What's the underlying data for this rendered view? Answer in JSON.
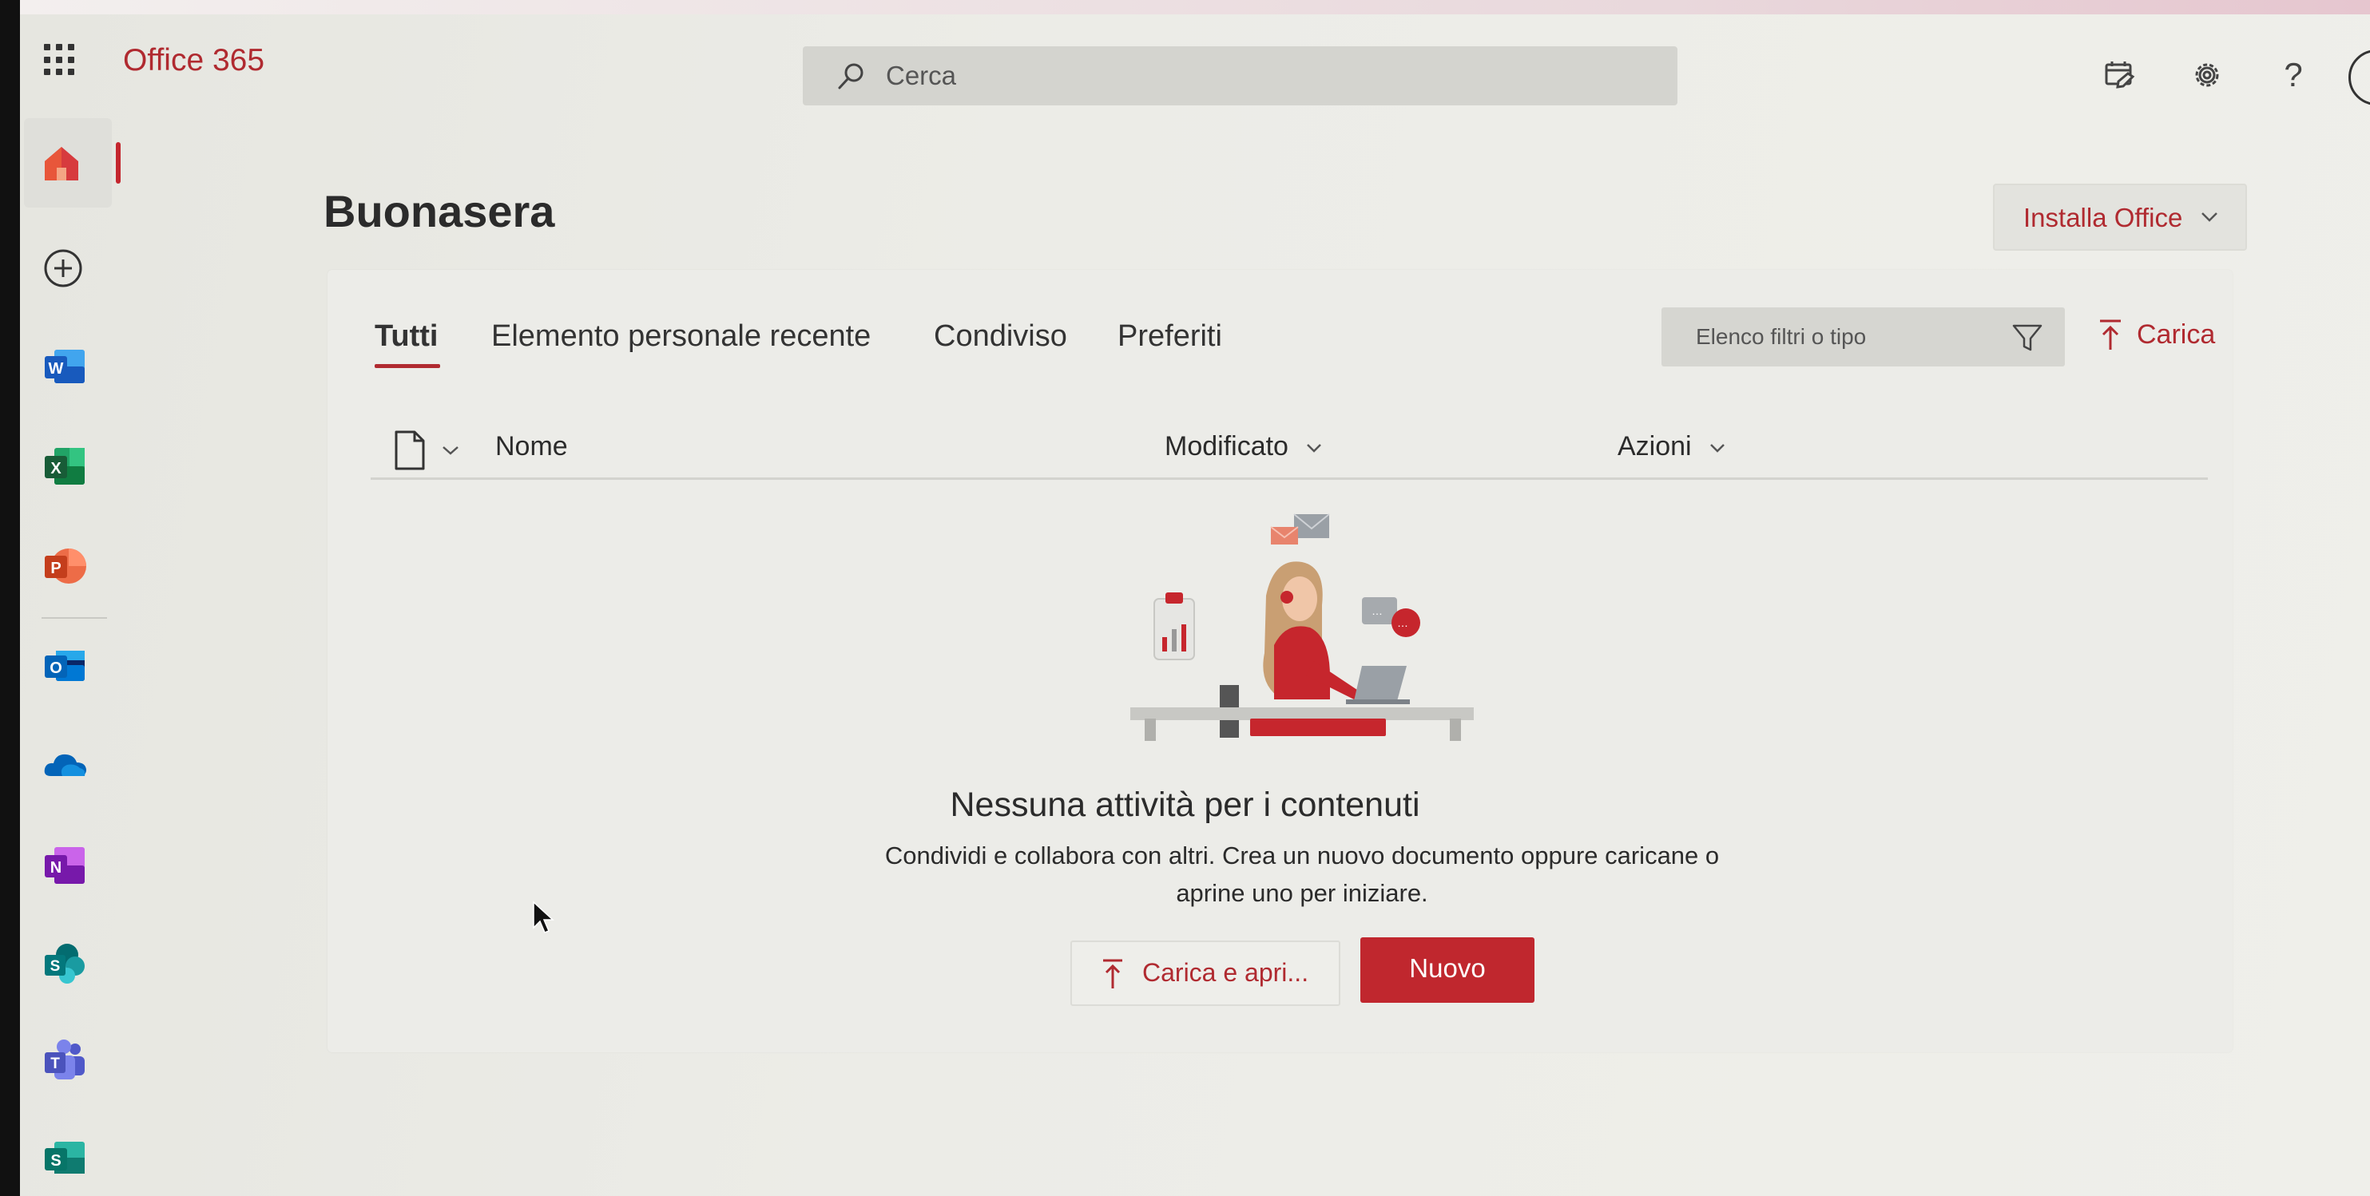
{
  "app": {
    "title": "Office 365"
  },
  "search": {
    "placeholder": "Cerca"
  },
  "header_icons": [
    "waffle-icon",
    "my-day-icon",
    "gear-icon",
    "help-icon",
    "avatar"
  ],
  "help": {
    "glyph": "?"
  },
  "left_rail": {
    "items": [
      {
        "name": "home",
        "icon": "home-icon",
        "active": true
      },
      {
        "name": "create",
        "icon": "add-circle-icon"
      },
      {
        "name": "word",
        "icon": "word-icon",
        "letter": "W",
        "color": "#2b579a"
      },
      {
        "name": "excel",
        "icon": "excel-icon",
        "letter": "X",
        "color": "#217346"
      },
      {
        "name": "powerpoint",
        "icon": "powerpoint-icon",
        "letter": "P",
        "color": "#d24726"
      },
      {
        "name": "outlook",
        "icon": "outlook-icon",
        "letter": "O",
        "color": "#0078d4"
      },
      {
        "name": "onedrive",
        "icon": "onedrive-icon",
        "color": "#0364b8"
      },
      {
        "name": "onenote",
        "icon": "onenote-icon",
        "letter": "N",
        "color": "#7719aa"
      },
      {
        "name": "sharepoint",
        "icon": "sharepoint-icon",
        "letter": "S",
        "color": "#038387"
      },
      {
        "name": "teams",
        "icon": "teams-icon",
        "color": "#4b53bc"
      },
      {
        "name": "sway",
        "icon": "sway-icon",
        "letter": "S",
        "color": "#008272"
      }
    ]
  },
  "main": {
    "greeting": "Buonasera",
    "install_button": "Installa Office",
    "tabs": [
      {
        "label": "Tutti",
        "active": true
      },
      {
        "label": "Elemento personale recente"
      },
      {
        "label": "Condiviso"
      },
      {
        "label": "Preferiti"
      }
    ],
    "filter_placeholder": "Elenco filtri o tipo",
    "upload_label": "Carica",
    "columns": {
      "name": "Nome",
      "modified": "Modificato",
      "actions": "Azioni"
    },
    "empty_state": {
      "title": "Nessuna attività per i contenuti",
      "subtitle_line1": "Condividi e collabora con altri. Crea un nuovo documento oppure caricane o",
      "subtitle_line2": "aprine uno per iniziare.",
      "upload_open_label": "Carica e apri...",
      "new_label": "Nuovo"
    }
  },
  "colors": {
    "accent": "#b02a30",
    "primary_button": "#c0272e",
    "background": "#ecece7"
  }
}
